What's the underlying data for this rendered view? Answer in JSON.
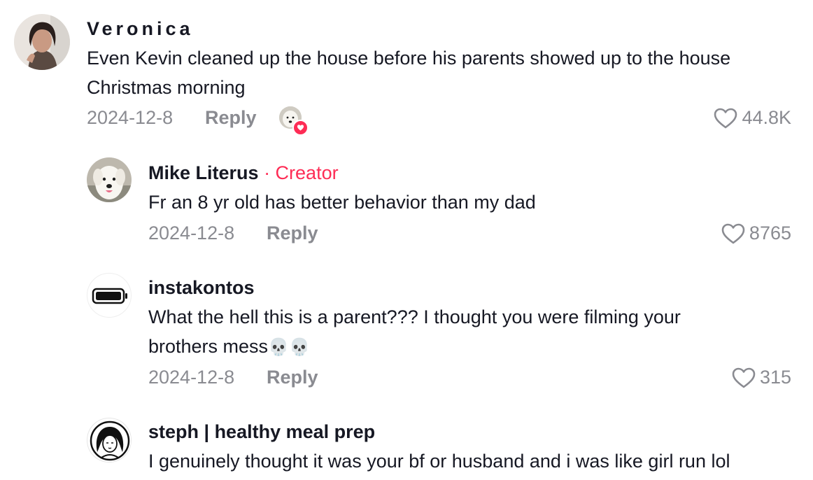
{
  "colors": {
    "creator_accent": "#fe2c55",
    "muted": "#8a8b91",
    "text": "#161823"
  },
  "comments": [
    {
      "username": "Veronica",
      "text_line1": "Even Kevin cleaned up the house before his parents showed up to the house",
      "text_line2": "Christmas morning",
      "date": "2024-12-8",
      "reply_label": "Reply",
      "likes": "44.8K",
      "creator_liked": true
    },
    {
      "username": "Mike Literus",
      "creator_label": "· Creator",
      "text_line1": "Fr an 8 yr old has better behavior than my dad",
      "date": "2024-12-8",
      "reply_label": "Reply",
      "likes": "8765"
    },
    {
      "username": "instakontos",
      "text_line1": "What the hell this is a parent??? I thought you were filming your",
      "text_line2": "brothers mess",
      "emoji": "💀💀",
      "date": "2024-12-8",
      "reply_label": "Reply",
      "likes": "315"
    },
    {
      "username": "steph | healthy meal prep",
      "text_line1": "I genuinely thought it was your bf or husband and i was like girl run lol"
    }
  ]
}
